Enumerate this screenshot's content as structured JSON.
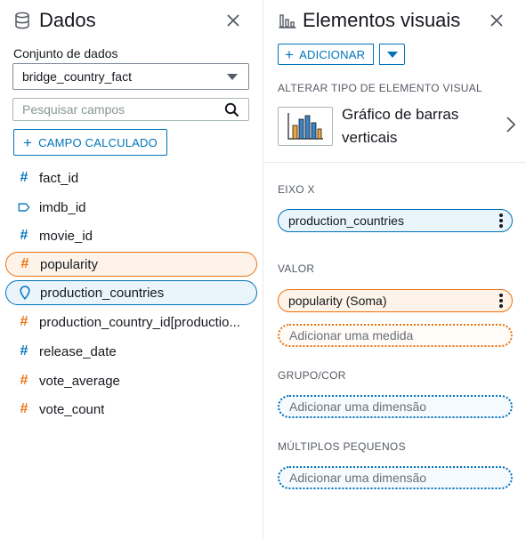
{
  "data_panel": {
    "title": "Dados",
    "icon": "database-icon",
    "dataset_label": "Conjunto de dados",
    "dataset_value": "bridge_country_fact",
    "search_placeholder": "Pesquisar campos",
    "calc_field_label": "CAMPO CALCULADO",
    "fields": [
      {
        "name": "fact_id",
        "icon": "hash-icon",
        "color": "#0073bb"
      },
      {
        "name": "imdb_id",
        "icon": "tag-icon",
        "color": "#0073bb"
      },
      {
        "name": "movie_id",
        "icon": "hash-icon",
        "color": "#0073bb"
      },
      {
        "name": "popularity",
        "icon": "hash-icon",
        "color": "#ec7211"
      },
      {
        "name": "production_countries",
        "icon": "location-pin-icon",
        "color": "#0073bb"
      },
      {
        "name": "production_country_id[productio...",
        "icon": "hash-icon",
        "color": "#ec7211"
      },
      {
        "name": "release_date",
        "icon": "hash-icon",
        "color": "#0073bb"
      },
      {
        "name": "vote_average",
        "icon": "hash-icon",
        "color": "#ec7211"
      },
      {
        "name": "vote_count",
        "icon": "hash-icon",
        "color": "#ec7211"
      }
    ]
  },
  "visuals_panel": {
    "title": "Elementos visuais",
    "icon": "bar-chart-icon",
    "add_label": "ADICIONAR",
    "change_type_label": "ALTERAR TIPO DE ELEMENTO VISUAL",
    "visual_type": "Gráfico de barras verticais",
    "x_axis_label": "EIXO X",
    "x_axis_field": "production_countries",
    "value_label": "VALOR",
    "value_field": "popularity (Soma)",
    "add_measure": "Adicionar uma medida",
    "group_label": "GRUPO/COR",
    "add_dimension_group": "Adicionar uma dimensão",
    "small_multiples_label": "MÚLTIPLOS PEQUENOS",
    "add_dimension_multiples": "Adicionar uma dimensão"
  },
  "colors": {
    "accent_blue": "#0073bb",
    "measure_orange": "#ec7211"
  }
}
